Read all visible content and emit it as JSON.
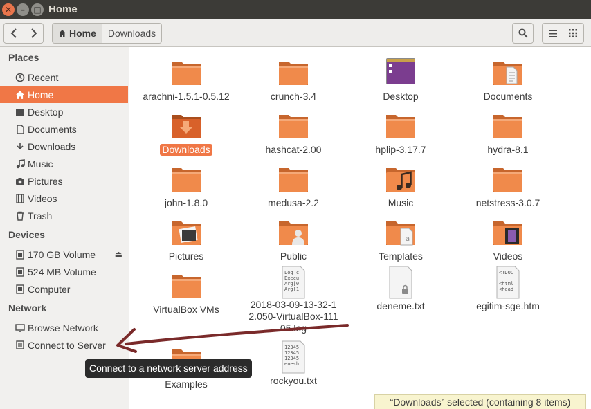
{
  "window": {
    "title": "Home"
  },
  "toolbar": {
    "path": [
      "Home",
      "Downloads"
    ]
  },
  "sidebar": {
    "places_title": "Places",
    "places": [
      {
        "label": "Recent",
        "icon": "clock-icon"
      },
      {
        "label": "Home",
        "icon": "home-icon",
        "selected": true
      },
      {
        "label": "Desktop",
        "icon": "desktop-icon"
      },
      {
        "label": "Documents",
        "icon": "document-icon"
      },
      {
        "label": "Downloads",
        "icon": "download-icon"
      },
      {
        "label": "Music",
        "icon": "music-icon"
      },
      {
        "label": "Pictures",
        "icon": "camera-icon"
      },
      {
        "label": "Videos",
        "icon": "film-icon"
      },
      {
        "label": "Trash",
        "icon": "trash-icon"
      }
    ],
    "devices_title": "Devices",
    "devices": [
      {
        "label": "170 GB Volume",
        "icon": "drive-icon",
        "eject": true
      },
      {
        "label": "524 MB Volume",
        "icon": "drive-icon"
      },
      {
        "label": "Computer",
        "icon": "drive-icon"
      }
    ],
    "network_title": "Network",
    "network": [
      {
        "label": "Browse Network",
        "icon": "network-icon"
      },
      {
        "label": "Connect to Server",
        "icon": "server-icon"
      }
    ]
  },
  "files": [
    {
      "label": "arachni-1.5.1-0.5.12",
      "type": "folder"
    },
    {
      "label": "crunch-3.4",
      "type": "folder"
    },
    {
      "label": "Desktop",
      "type": "folder-desktop"
    },
    {
      "label": "Documents",
      "type": "folder-documents"
    },
    {
      "label": "Downloads",
      "type": "folder-downloads",
      "selected": true
    },
    {
      "label": "hashcat-2.00",
      "type": "folder"
    },
    {
      "label": "hplip-3.17.7",
      "type": "folder"
    },
    {
      "label": "hydra-8.1",
      "type": "folder"
    },
    {
      "label": "john-1.8.0",
      "type": "folder"
    },
    {
      "label": "medusa-2.2",
      "type": "folder"
    },
    {
      "label": "Music",
      "type": "folder-music"
    },
    {
      "label": "netstress-3.0.7",
      "type": "folder"
    },
    {
      "label": "Pictures",
      "type": "folder-pictures"
    },
    {
      "label": "Public",
      "type": "folder-public"
    },
    {
      "label": "Templates",
      "type": "folder-templates"
    },
    {
      "label": "Videos",
      "type": "folder-videos"
    },
    {
      "label": "VirtualBox VMs",
      "type": "folder"
    },
    {
      "label": "2018-03-09-13-32-12.050-VirtualBox-11105.log",
      "type": "text-log"
    },
    {
      "label": "deneme.txt",
      "type": "text-locked"
    },
    {
      "label": "egitim-sge.htm",
      "type": "text-html"
    },
    {
      "label": "Examples",
      "type": "folder"
    },
    {
      "label": "rockyou.txt",
      "type": "text-numbers"
    }
  ],
  "file_previews": {
    "log": [
      "Log c",
      "Execu",
      "Arg[0",
      "Arg[1"
    ],
    "html": [
      "<!DOC",
      "",
      "<html",
      "<head"
    ],
    "numbers": [
      "12345",
      "12345",
      "12345",
      "enesh"
    ]
  },
  "tooltip": "Connect to a network server address",
  "status": "“Downloads” selected  (containing 8 items)",
  "colors": {
    "accent": "#f07746",
    "folder": "#f08a4b",
    "titlebar": "#3c3b37",
    "annotation_arrow": "#7a2a2a"
  }
}
